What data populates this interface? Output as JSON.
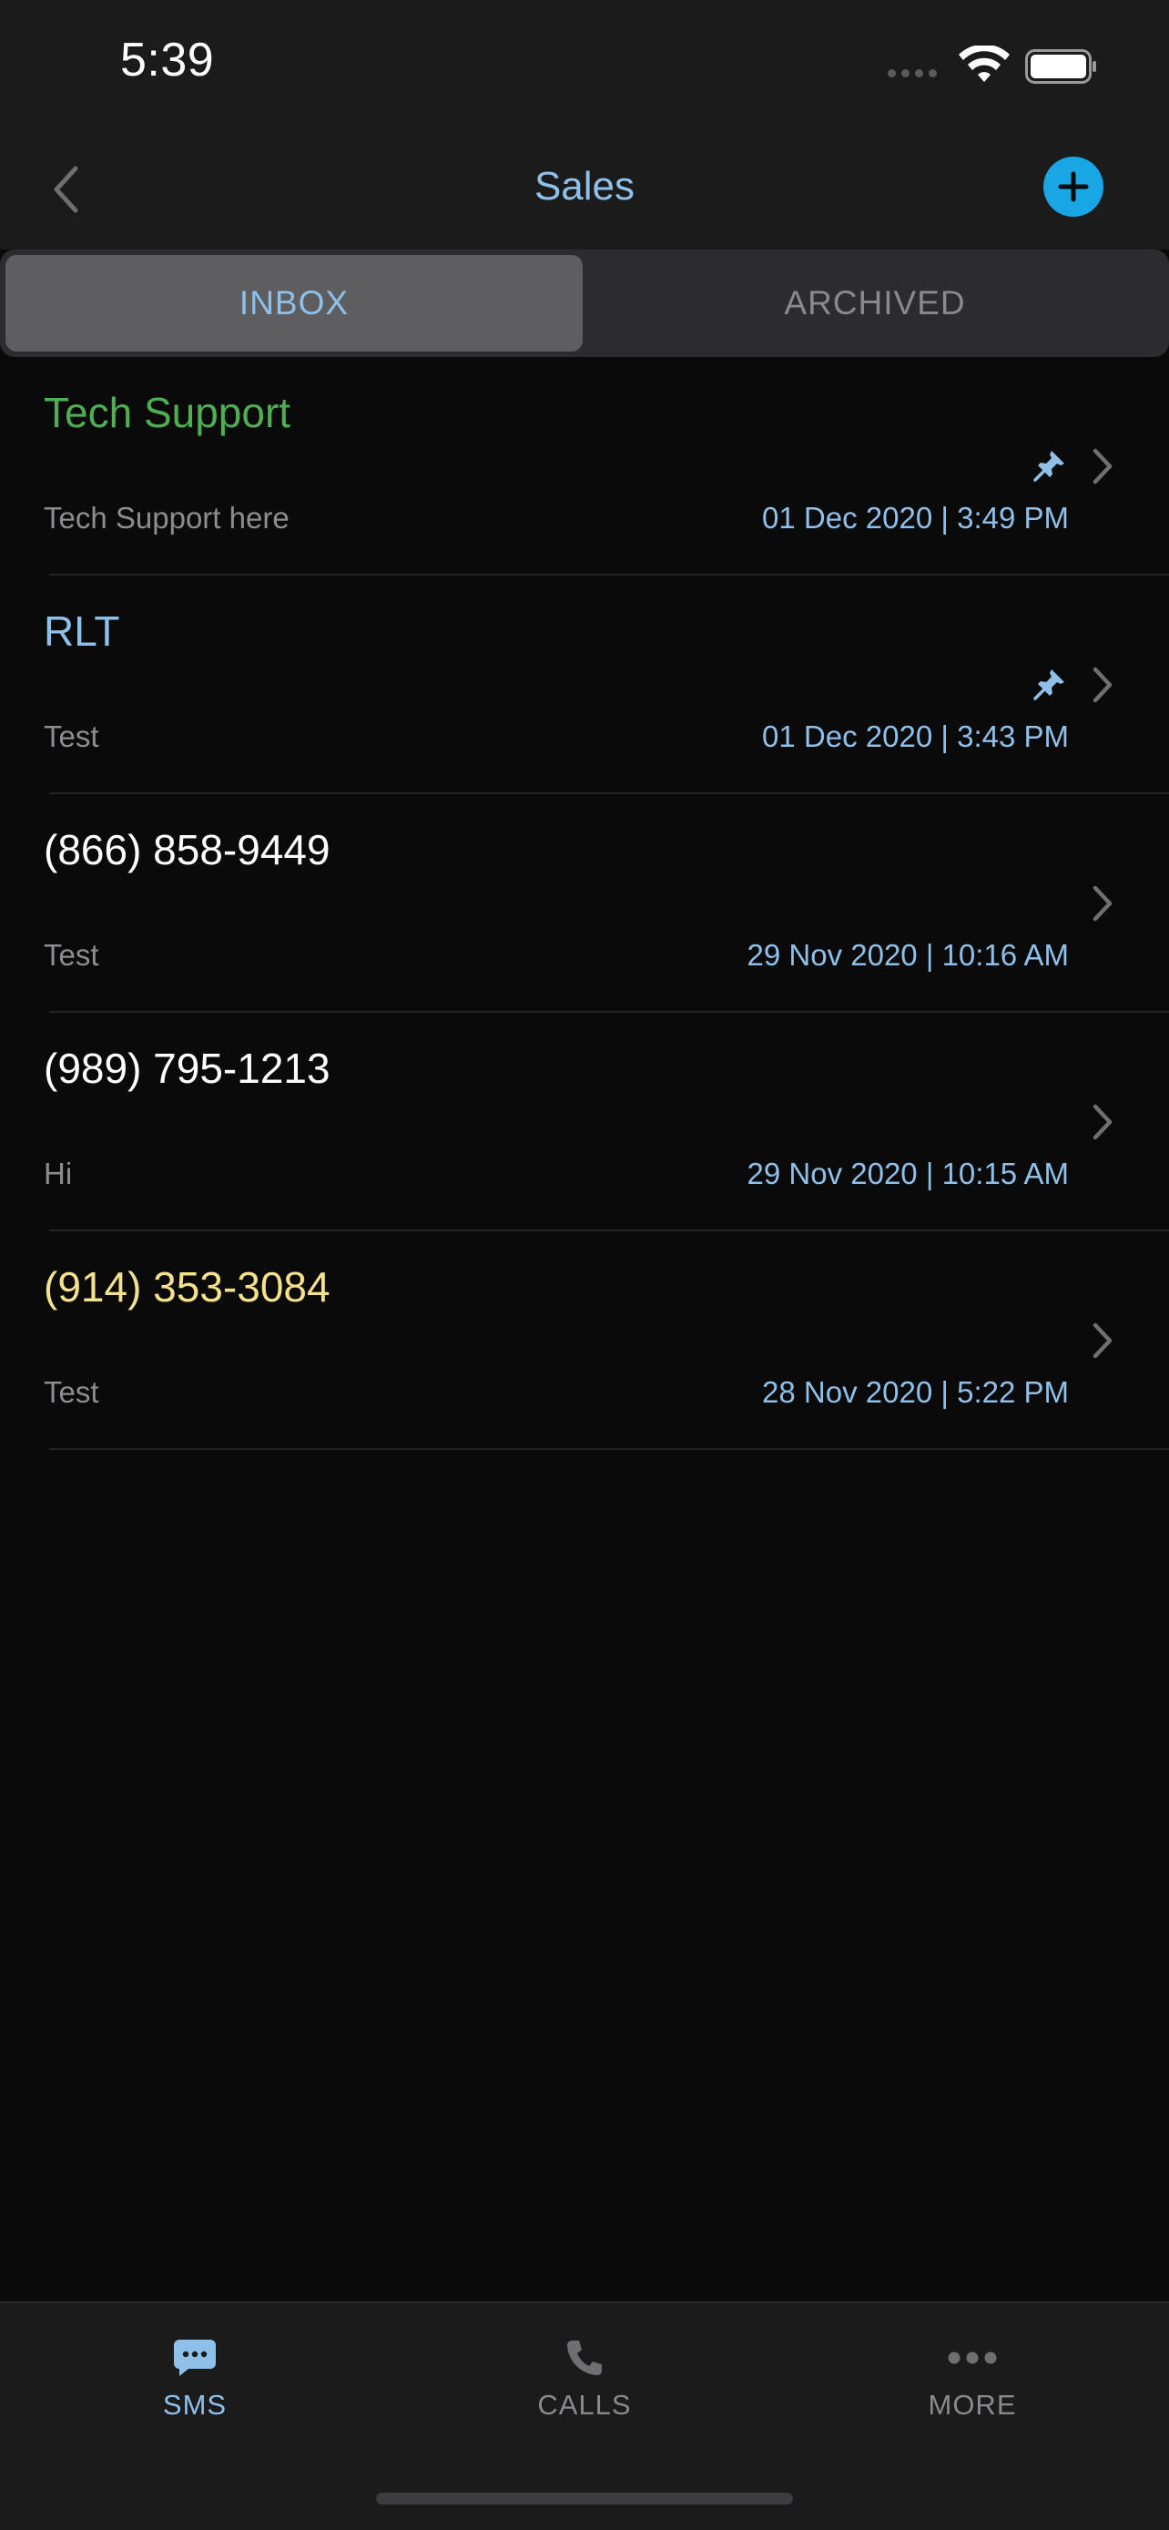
{
  "status_bar": {
    "time": "5:39"
  },
  "nav": {
    "title": "Sales",
    "back_icon": "chevron-left-icon",
    "add_icon": "plus-icon"
  },
  "segments": [
    {
      "label": "INBOX",
      "active": true
    },
    {
      "label": "ARCHIVED",
      "active": false
    }
  ],
  "conversations": [
    {
      "name": "Tech Support",
      "name_color": "#4fae52",
      "preview": "Tech Support here",
      "date": "01 Dec 2020 | 3:49 PM",
      "pinned": true
    },
    {
      "name": "RLT",
      "name_color": "#8ec0ea",
      "preview": "Test",
      "date": "01 Dec 2020 | 3:43 PM",
      "pinned": true
    },
    {
      "name": "(866) 858-9449",
      "name_color": "#ffffff",
      "preview": "Test",
      "date": "29 Nov 2020 | 10:16 AM",
      "pinned": false
    },
    {
      "name": "(989) 795-1213",
      "name_color": "#ffffff",
      "preview": "Hi",
      "date": "29 Nov 2020 | 10:15 AM",
      "pinned": false
    },
    {
      "name": "(914) 353-3084",
      "name_color": "#f3e18c",
      "preview": "Test",
      "date": "28 Nov 2020 | 5:22 PM",
      "pinned": false
    }
  ],
  "tabs": [
    {
      "label": "SMS",
      "icon": "chat-bubble-icon",
      "active": true
    },
    {
      "label": "CALLS",
      "icon": "phone-icon",
      "active": false
    },
    {
      "label": "MORE",
      "icon": "more-dots-icon",
      "active": false
    }
  ],
  "colors": {
    "accent": "#8ec0ea",
    "add_button": "#18a6e4",
    "inactive": "#8a8a8c"
  }
}
